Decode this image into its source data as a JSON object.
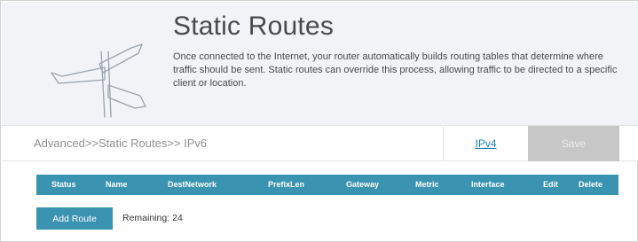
{
  "header": {
    "title": "Static Routes",
    "description": "Once connected to the Internet, your router automatically builds routing tables that determine where traffic should be sent. Static routes can override this process, allowing traffic to be directed to a specific client or location."
  },
  "nav": {
    "breadcrumb": "Advanced>>Static Routes>> IPv6",
    "ipv4_link": "IPv4",
    "save_label": "Save"
  },
  "table": {
    "columns": [
      "Status",
      "Name",
      "DestNetwork",
      "PrefixLen",
      "Gateway",
      "Metric",
      "Interface",
      "Edit",
      "Delete"
    ]
  },
  "actions": {
    "add_route_label": "Add Route",
    "remaining_label": "Remaining:",
    "remaining_value": "24"
  },
  "colors": {
    "accent": "#3a93b0",
    "banner_bg": "#f1f3f6",
    "save_disabled": "#c7c7c7",
    "link": "#1a7fb7"
  },
  "icons": {
    "banner_illustration": "signpost-icon"
  }
}
